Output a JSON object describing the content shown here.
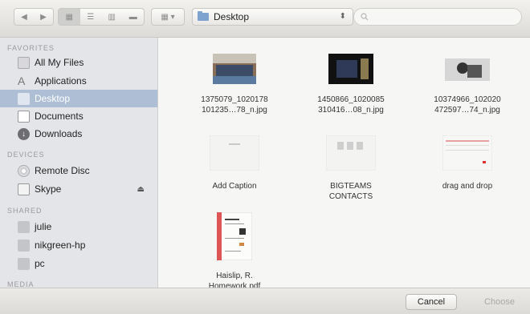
{
  "toolbar": {
    "back_icon": "chevron-left-icon",
    "forward_icon": "chevron-right-icon",
    "view_modes": [
      "icon-view-icon",
      "list-view-icon",
      "column-view-icon",
      "coverflow-view-icon"
    ],
    "arrange_icon": "arrange-grid-icon",
    "location": "Desktop",
    "search_placeholder": "",
    "search_icon": "search-icon"
  },
  "sidebar": {
    "favorites": {
      "header": "FAVORITES",
      "items": [
        {
          "label": "All My Files",
          "icon": "all-files-icon"
        },
        {
          "label": "Applications",
          "icon": "applications-icon"
        },
        {
          "label": "Desktop",
          "icon": "desktop-icon",
          "selected": true
        },
        {
          "label": "Documents",
          "icon": "documents-icon"
        },
        {
          "label": "Downloads",
          "icon": "downloads-icon"
        }
      ]
    },
    "devices": {
      "header": "DEVICES",
      "items": [
        {
          "label": "Remote Disc",
          "icon": "disc-icon"
        },
        {
          "label": "Skype",
          "icon": "drive-icon",
          "eject": true
        }
      ]
    },
    "shared": {
      "header": "SHARED",
      "items": [
        {
          "label": "julie",
          "icon": "network-computer-icon"
        },
        {
          "label": "nikgreen-hp",
          "icon": "network-computer-icon"
        },
        {
          "label": "pc",
          "icon": "network-computer-icon"
        }
      ]
    },
    "media": {
      "header": "MEDIA"
    }
  },
  "files": [
    {
      "line1": "1375079_1020178",
      "line2": "101235…78_n.jpg",
      "kind": "photo-crowd"
    },
    {
      "line1": "1450866_1020085",
      "line2": "310416…08_n.jpg",
      "kind": "photo-dark"
    },
    {
      "line1": "10374966_102020",
      "line2": "472597…74_n.jpg",
      "kind": "photo-bw"
    },
    {
      "line1": "Add Caption",
      "line2": "",
      "kind": "doc-blank"
    },
    {
      "line1": "BIGTEAMS",
      "line2": "CONTACTS",
      "kind": "doc-text"
    },
    {
      "line1": "drag and drop",
      "line2": "",
      "kind": "doc-lines"
    },
    {
      "line1": "Haislip, R.",
      "line2": "Homework.pdf",
      "kind": "pdf"
    }
  ],
  "buttons": {
    "cancel": "Cancel",
    "choose": "Choose"
  }
}
